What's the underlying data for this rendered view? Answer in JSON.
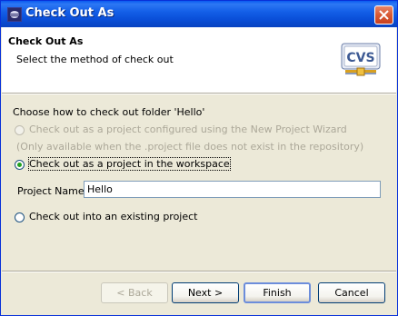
{
  "window": {
    "title": "Check Out As"
  },
  "header": {
    "title": "Check Out As",
    "description": "Select the method of check out",
    "logo_text": "CVS"
  },
  "content": {
    "prompt": "Choose how to check out folder 'Hello'",
    "option_new_project_wizard": "Check out as a project configured using the New Project Wizard",
    "option_new_project_wizard_note": "(Only available when the .project file does not exist in the repository)",
    "option_workspace": "Check out as a project in the workspace",
    "project_name_label": "Project Name:",
    "project_name_value": "Hello",
    "option_existing": "Check out into an existing project"
  },
  "buttons": {
    "back": "< Back",
    "next": "Next >",
    "finish": "Finish",
    "cancel": "Cancel"
  },
  "colors": {
    "titlebar": "#0a5bf0",
    "dialog_bg": "#ece9d8",
    "radio_selected": "#21a121"
  }
}
